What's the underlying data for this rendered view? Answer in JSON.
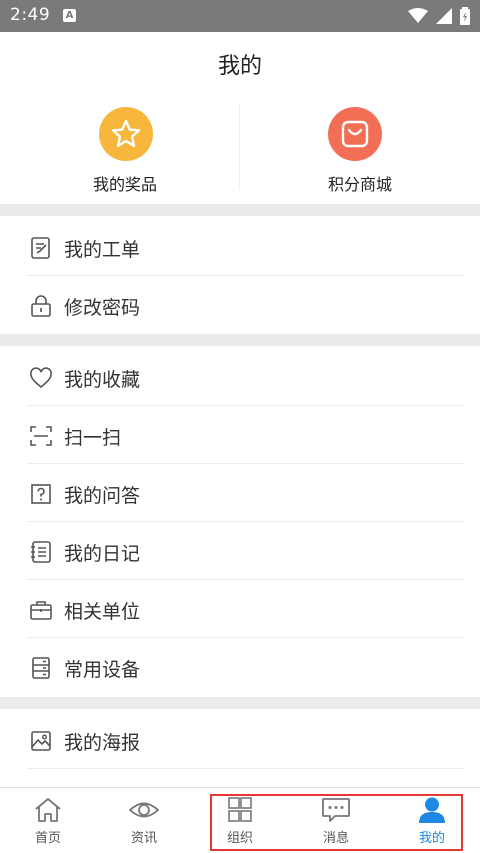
{
  "status_bar": {
    "time": "2:49",
    "notification_badge": "A"
  },
  "page": {
    "title": "我的"
  },
  "features": [
    {
      "label": "我的奖品",
      "icon": "star-icon",
      "color": "#f6b73c"
    },
    {
      "label": "积分商城",
      "icon": "shopping-bag-icon",
      "color": "#f26e55"
    }
  ],
  "menu": {
    "group1": [
      {
        "label": "我的工单",
        "icon": "work-order-icon"
      },
      {
        "label": "修改密码",
        "icon": "lock-icon"
      }
    ],
    "group2": [
      {
        "label": "我的收藏",
        "icon": "heart-icon"
      },
      {
        "label": "扫一扫",
        "icon": "scan-icon"
      },
      {
        "label": "我的问答",
        "icon": "question-icon"
      },
      {
        "label": "我的日记",
        "icon": "diary-icon"
      },
      {
        "label": "相关单位",
        "icon": "briefcase-icon"
      },
      {
        "label": "常用设备",
        "icon": "device-icon"
      }
    ],
    "group3": [
      {
        "label": "我的海报",
        "icon": "image-icon"
      }
    ]
  },
  "tabs": [
    {
      "label": "首页",
      "icon": "home-icon"
    },
    {
      "label": "资讯",
      "icon": "eye-icon"
    },
    {
      "label": "组织",
      "icon": "grid-icon"
    },
    {
      "label": "消息",
      "icon": "chat-icon"
    },
    {
      "label": "我的",
      "icon": "user-icon",
      "active": true
    }
  ],
  "colors": {
    "accent": "#1e88e5",
    "highlight": "#e53935",
    "divider": "#ebebeb"
  }
}
